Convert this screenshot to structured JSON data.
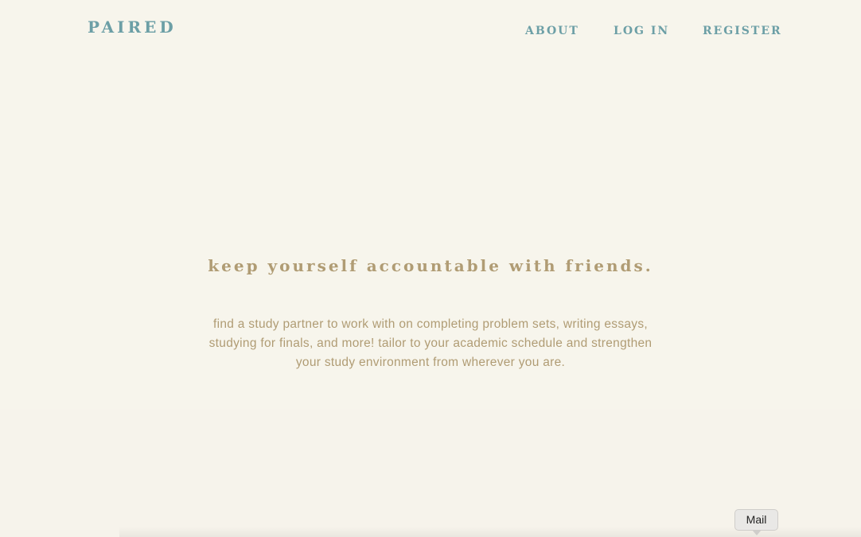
{
  "header": {
    "logo": "PAIRED",
    "nav": {
      "about": "ABOUT",
      "login": "LOG IN",
      "register": "REGISTER"
    }
  },
  "hero": {
    "headline": "keep yourself accountable with friends.",
    "description": "find a study partner to work with on completing problem sets, writing essays, studying for finals, and more! tailor to your academic schedule and strengthen your study environment from wherever you are."
  },
  "dock": {
    "tooltip": "Mail"
  },
  "colors": {
    "background": "#f7f5ed",
    "accent_teal": "#6c9fa6",
    "text_tan": "#b09c74"
  }
}
